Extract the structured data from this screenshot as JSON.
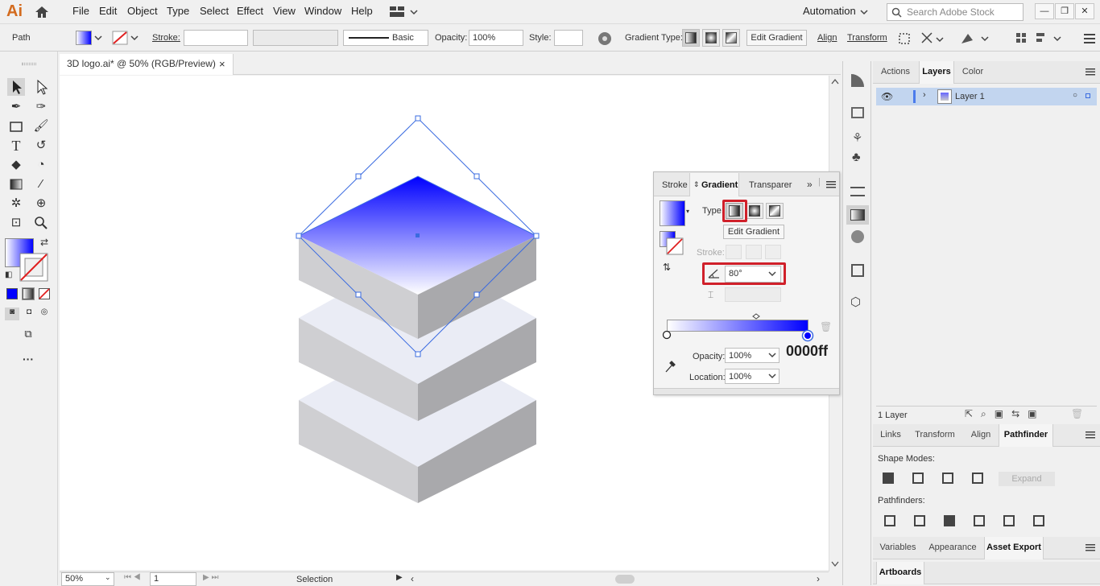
{
  "app": {
    "logo": "Ai"
  },
  "menu": [
    "File",
    "Edit",
    "Object",
    "Type",
    "Select",
    "Effect",
    "View",
    "Window",
    "Help"
  ],
  "workspace": "Automation",
  "search_placeholder": "Search Adobe Stock",
  "control": {
    "path_label": "Path",
    "stroke_label": "Stroke:",
    "stroke_style": "Basic",
    "opacity_label": "Opacity:",
    "opacity_value": "100%",
    "style_label": "Style:",
    "gradient_type_label": "Gradient Type:",
    "edit_gradient": "Edit Gradient",
    "align": "Align",
    "transform": "Transform"
  },
  "document": {
    "tab_title": "3D logo.ai* @ 50% (RGB/Preview)",
    "close": "×"
  },
  "status": {
    "zoom": "50%",
    "artboard": "1",
    "mode": "Selection"
  },
  "gradient_panel": {
    "tabs": [
      "Stroke",
      "Gradient",
      "Transparer"
    ],
    "type_label": "Type:",
    "edit_gradient": "Edit Gradient",
    "stroke_label": "Stroke:",
    "angle_value": "80°",
    "opacity_label": "Opacity:",
    "opacity_value": "100%",
    "location_label": "Location:",
    "location_value": "100%",
    "color_hex": "0000ff",
    "colors": {
      "start": "#ffffff",
      "end": "#0000ff"
    }
  },
  "layers_panel": {
    "tabs": [
      "Actions",
      "Layers",
      "Color"
    ],
    "layer_name": "Layer 1",
    "count": "1 Layer"
  },
  "pathfinder_panel": {
    "tabs": [
      "Links",
      "Transform",
      "Align",
      "Pathfinder"
    ],
    "shape_modes": "Shape Modes:",
    "expand": "Expand",
    "pathfinders": "Pathfinders:"
  },
  "bottom_panel": {
    "tabs": [
      "Variables",
      "Appearance",
      "Asset Export"
    ],
    "artboards": "Artboards"
  }
}
